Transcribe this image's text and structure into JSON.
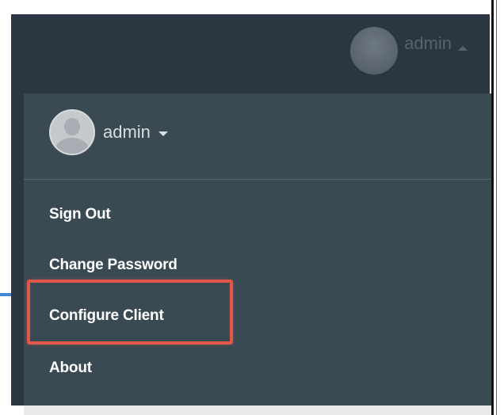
{
  "header": {
    "username": "admin"
  },
  "user_menu": {
    "username": "admin",
    "items": [
      {
        "label": "Sign Out"
      },
      {
        "label": "Change Password"
      },
      {
        "label": "Configure Client"
      },
      {
        "label": "About"
      }
    ],
    "highlighted_item": "Configure Client"
  },
  "colors": {
    "header_bg": "#2a3641",
    "menu_bg": "#3a4a52",
    "highlight_border": "#e3564a",
    "connector_line": "#3d89d6"
  },
  "icons": {
    "header_avatar": "user-avatar-icon",
    "menu_avatar": "user-avatar-icon",
    "header_caret": "caret-up-icon",
    "menu_caret": "caret-down-icon"
  }
}
